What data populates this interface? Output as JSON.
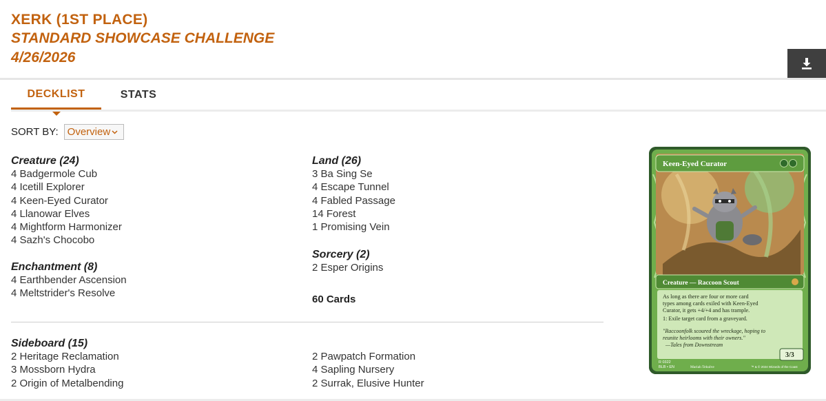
{
  "header": {
    "player": "XERK (1ST PLACE)",
    "event": "STANDARD SHOWCASE CHALLENGE",
    "date": "4/26/2026"
  },
  "tabs": [
    {
      "label": "DECKLIST",
      "active": true
    },
    {
      "label": "STATS",
      "active": false
    }
  ],
  "sort": {
    "label": "SORT BY:",
    "selected": "Overview"
  },
  "deck": {
    "creature": {
      "title": "Creature (24)",
      "cards": [
        "4 Badgermole Cub",
        "4 Icetill Explorer",
        "4 Keen-Eyed Curator",
        "4 Llanowar Elves",
        "4 Mightform Harmonizer",
        "4 Sazh's Chocobo"
      ]
    },
    "enchantment": {
      "title": "Enchantment (8)",
      "cards": [
        "4 Earthbender Ascension",
        "4 Meltstrider's Resolve"
      ]
    },
    "land": {
      "title": "Land (26)",
      "cards": [
        "3 Ba Sing Se",
        "4 Escape Tunnel",
        "4 Fabled Passage",
        "14 Forest",
        "1 Promising Vein"
      ]
    },
    "sorcery": {
      "title": "Sorcery (2)",
      "cards": [
        "2 Esper Origins"
      ]
    },
    "total": "60 Cards"
  },
  "sideboard": {
    "title": "Sideboard (15)",
    "left": [
      "2 Heritage Reclamation",
      "3 Mossborn Hydra",
      "2 Origin of Metalbending"
    ],
    "right": [
      "2 Pawpatch Formation",
      "4 Sapling Nursery",
      "2 Surrak, Elusive Hunter"
    ]
  },
  "featured_card": {
    "name": "Keen-Eyed Curator",
    "type_line": "Creature — Raccoon Scout",
    "rules": [
      "As long as there are four or more card",
      "types among cards exiled with Keen-Eyed",
      "Curator, it gets +4/+4 and has trample.",
      "1: Exile target card from a graveyard."
    ],
    "flavor": [
      "\"Raccoonfolk scoured the wreckage, hoping to",
      "reunite heirlooms with their owners.\"",
      "—Tales from Downstream"
    ],
    "pt": "3/3",
    "collector": [
      "R 0322",
      "BLB • EN"
    ],
    "artist": "Mariah Tekulve",
    "copyright": "™ & © 2024 Wizards of the Coast"
  },
  "colors": {
    "accent": "#c2620f",
    "download_bg": "#3f3f3f",
    "card_frame": "#5e9c3f"
  },
  "icons": {
    "download": "download-icon",
    "dropdown": "chevron-down-icon"
  }
}
